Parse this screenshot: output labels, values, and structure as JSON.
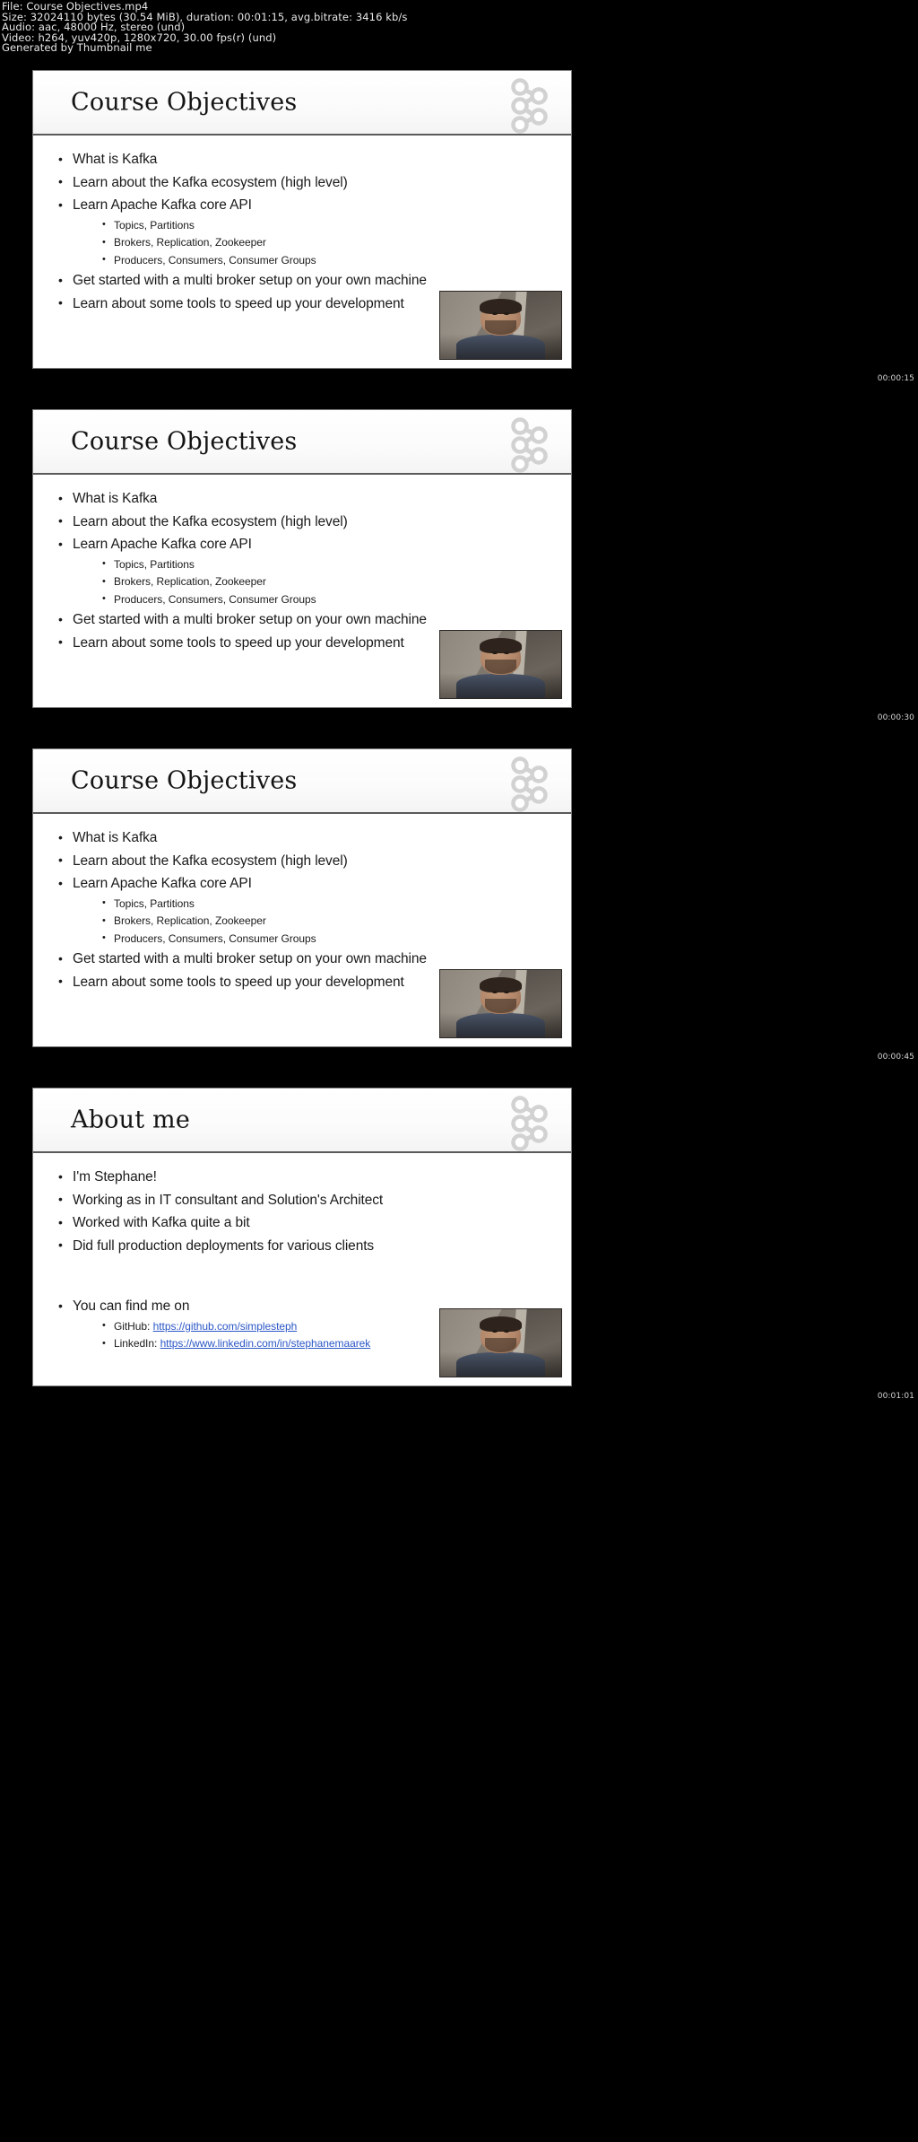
{
  "meta": {
    "file_line": "File: Course Objectives.mp4",
    "size_line": "Size: 32024110 bytes (30.54 MiB), duration: 00:01:15, avg.bitrate: 3416 kb/s",
    "audio_line": "Audio: aac, 48000 Hz, stereo (und)",
    "video_line": "Video: h264, yuv420p, 1280x720, 30.00 fps(r) (und)",
    "generator_line": "Generated by Thumbnail me"
  },
  "slides": [
    {
      "title": "Course Objectives",
      "timestamp": "00:00:15",
      "bullets": [
        {
          "text": "What is Kafka",
          "sub": []
        },
        {
          "text": "Learn about the Kafka ecosystem (high level)",
          "sub": []
        },
        {
          "text": "Learn Apache Kafka core API",
          "sub": [
            "Topics, Partitions",
            "Brokers, Replication, Zookeeper",
            "Producers, Consumers, Consumer Groups"
          ]
        },
        {
          "text": "Get started with a multi broker setup on your own machine",
          "sub": []
        },
        {
          "text": "Learn about some tools to speed up your development",
          "sub": []
        }
      ]
    },
    {
      "title": "Course Objectives",
      "timestamp": "00:00:30",
      "bullets": [
        {
          "text": "What is Kafka",
          "sub": []
        },
        {
          "text": "Learn about the Kafka ecosystem (high level)",
          "sub": []
        },
        {
          "text": "Learn Apache Kafka core API",
          "sub": [
            "Topics, Partitions",
            "Brokers, Replication, Zookeeper",
            "Producers, Consumers, Consumer Groups"
          ]
        },
        {
          "text": "Get started with a multi broker setup on your own machine",
          "sub": []
        },
        {
          "text": "Learn about some tools to speed up your development",
          "sub": []
        }
      ]
    },
    {
      "title": "Course Objectives",
      "timestamp": "00:00:45",
      "bullets": [
        {
          "text": "What is Kafka",
          "sub": []
        },
        {
          "text": "Learn about the Kafka ecosystem (high level)",
          "sub": []
        },
        {
          "text": "Learn Apache Kafka core API",
          "sub": [
            "Topics, Partitions",
            "Brokers, Replication, Zookeeper",
            "Producers, Consumers, Consumer Groups"
          ]
        },
        {
          "text": "Get started with a multi broker setup on your own machine",
          "sub": []
        },
        {
          "text": "Learn about some tools to speed up your development",
          "sub": []
        }
      ]
    },
    {
      "title": "About me",
      "timestamp": "00:01:01",
      "bullets": [
        {
          "text": "I'm Stephane!",
          "sub": []
        },
        {
          "text": "Working as in IT consultant and Solution's Architect",
          "sub": []
        },
        {
          "text": "Worked with Kafka quite a bit",
          "sub": []
        },
        {
          "text": "Did full production deployments for various clients",
          "sub": []
        }
      ],
      "contact": {
        "heading": "You can find me on",
        "items": [
          {
            "label": "GitHub:",
            "url": "https://github.com/simplesteph"
          },
          {
            "label": "LinkedIn:",
            "url": "https://www.linkedin.com/in/stephanemaarek"
          }
        ]
      }
    }
  ],
  "colors": {
    "background": "#000000",
    "slide_background": "#ffffff",
    "text": "#1a1a1a",
    "link": "#2a56c6",
    "logo": "#d4d4d4",
    "meta_text": "#e8e8e8"
  }
}
